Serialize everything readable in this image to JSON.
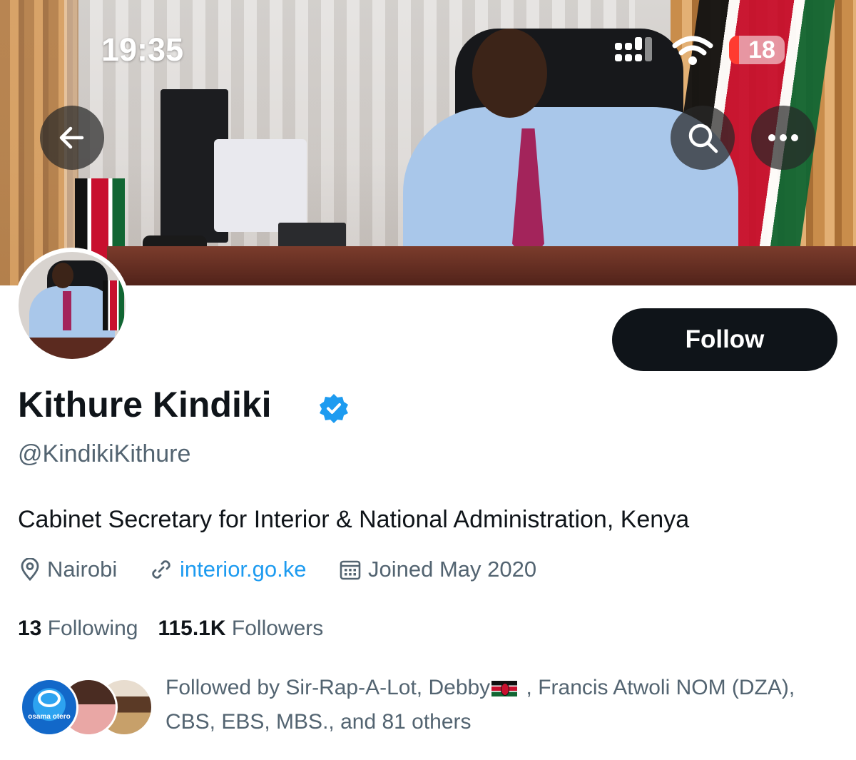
{
  "status_bar": {
    "time": "19:35",
    "battery_level": "18",
    "icons": [
      "cellular-signal-icon",
      "wifi-icon",
      "battery-icon"
    ]
  },
  "header": {
    "back_icon": "arrow-left-icon",
    "search_icon": "search-icon",
    "more_icon": "more-horizontal-icon"
  },
  "profile": {
    "display_name": "Kithure Kindiki",
    "verified": true,
    "handle": "@KindikiKithure",
    "bio": "Cabinet Secretary for Interior & National Administration, Kenya",
    "location": "Nairobi",
    "website": "interior.go.ke",
    "joined": "Joined May 2020",
    "follow_label": "Follow"
  },
  "stats": {
    "following_count": "13",
    "following_label": "Following",
    "followers_count": "115.1K",
    "followers_label": "Followers"
  },
  "followed_by": {
    "prefix": "Followed by Sir-Rap-A-Lot, Debby",
    "suffix": " , Francis Atwoli NOM (DZA), CBS, EBS, MBS., and 81 others",
    "avatar_1_text": "osama otero"
  },
  "colors": {
    "accent": "#1d9bf0",
    "primary_text": "#0f1419",
    "secondary_text": "#536471",
    "button_bg": "#0f1419"
  }
}
